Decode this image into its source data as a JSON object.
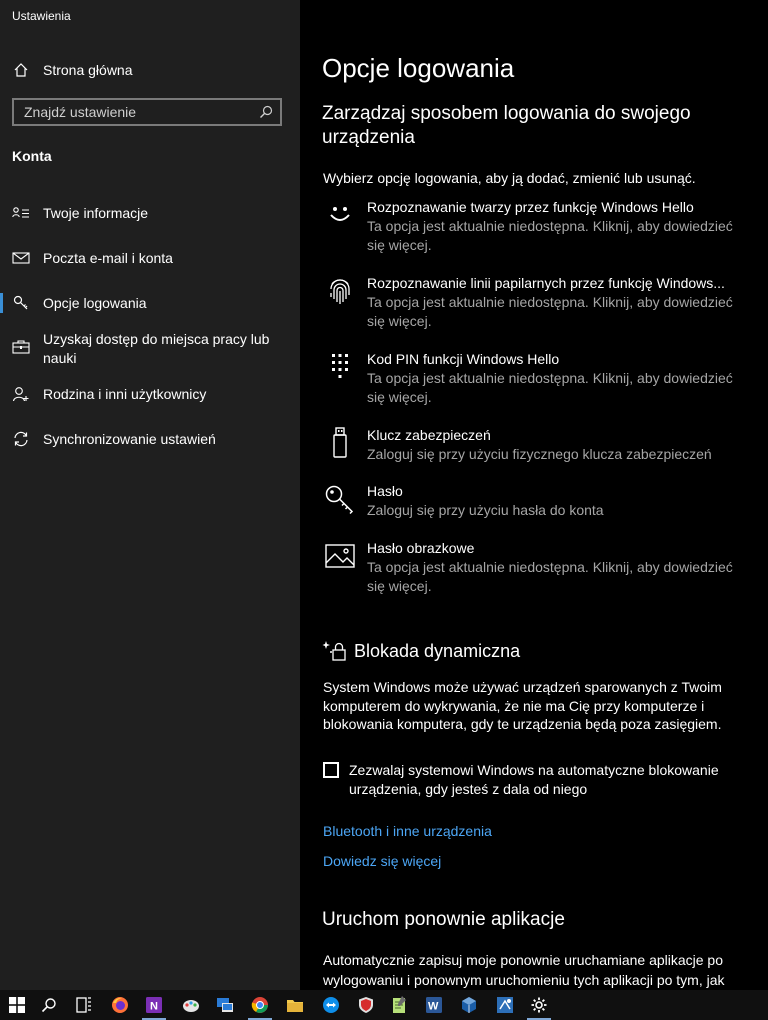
{
  "window": {
    "title": "Ustawienia"
  },
  "sidebar": {
    "home_label": "Strona główna",
    "search_placeholder": "Znajdź ustawienie",
    "section_label": "Konta",
    "items": [
      {
        "label": "Twoje informacje",
        "icon": "person-card-icon"
      },
      {
        "label": "Poczta e-mail i konta",
        "icon": "mail-icon"
      },
      {
        "label": "Opcje logowania",
        "icon": "key-icon",
        "active": true
      },
      {
        "label": "Uzyskaj dostęp do miejsca pracy lub nauki",
        "icon": "briefcase-icon"
      },
      {
        "label": "Rodzina i inni użytkownicy",
        "icon": "person-add-icon"
      },
      {
        "label": "Synchronizowanie ustawień",
        "icon": "sync-icon"
      }
    ]
  },
  "main": {
    "title": "Opcje logowania",
    "subtitle": "Zarządzaj sposobem logowania do swojego urządzenia",
    "intro": "Wybierz opcję logowania, aby ją dodać, zmienić lub usunąć.",
    "options": [
      {
        "title": "Rozpoznawanie twarzy przez funkcję Windows Hello",
        "desc": "Ta opcja jest aktualnie niedostępna. Kliknij, aby dowiedzieć się więcej.",
        "icon": "face-icon"
      },
      {
        "title": "Rozpoznawanie linii papilarnych przez funkcję Windows...",
        "desc": "Ta opcja jest aktualnie niedostępna. Kliknij, aby dowiedzieć się więcej.",
        "icon": "fingerprint-icon"
      },
      {
        "title": "Kod PIN funkcji Windows Hello",
        "desc": "Ta opcja jest aktualnie niedostępna. Kliknij, aby dowiedzieć się więcej.",
        "icon": "pin-keypad-icon"
      },
      {
        "title": "Klucz zabezpieczeń",
        "desc": "Zaloguj się przy użyciu fizycznego klucza zabezpieczeń",
        "icon": "usb-key-icon"
      },
      {
        "title": "Hasło",
        "desc": "Zaloguj się przy użyciu hasła do konta",
        "icon": "password-key-icon"
      },
      {
        "title": "Hasło obrazkowe",
        "desc": "Ta opcja jest aktualnie niedostępna. Kliknij, aby dowiedzieć się więcej.",
        "icon": "picture-icon"
      }
    ],
    "dynamic_lock": {
      "title": "Blokada dynamiczna",
      "desc": "System Windows może używać urządzeń sparowanych z Twoim komputerem do wykrywania, że nie ma Cię przy komputerze i blokowania komputera, gdy te urządzenia będą poza zasięgiem.",
      "checkbox_label": "Zezwalaj systemowi Windows na automatyczne blokowanie urządzenia, gdy jesteś z dala od niego",
      "checked": false,
      "links": [
        "Bluetooth i inne urządzenia",
        "Dowiedz się więcej"
      ]
    },
    "restart_apps": {
      "title": "Uruchom ponownie aplikacje",
      "desc": "Automatycznie zapisuj moje ponownie uruchamiane aplikacje po wylogowaniu i ponownym uruchomieniu tych aplikacji po tym, jak"
    }
  },
  "taskbar": {
    "items": [
      "windows-start-icon",
      "search-icon",
      "task-view-icon",
      "firefox-icon",
      "onenote-icon",
      "paint-icon",
      "remote-desktop-icon",
      "chrome-icon",
      "file-explorer-icon",
      "teamviewer-icon",
      "shield-app-icon",
      "notepad-icon",
      "word-icon",
      "virtualbox-icon",
      "network-tool-icon",
      "settings-icon"
    ]
  },
  "colors": {
    "sidebar_bg": "#1f1f1f",
    "main_bg": "#000000",
    "accent": "#4ca6f5",
    "secondary_text": "#a6a6a6"
  }
}
